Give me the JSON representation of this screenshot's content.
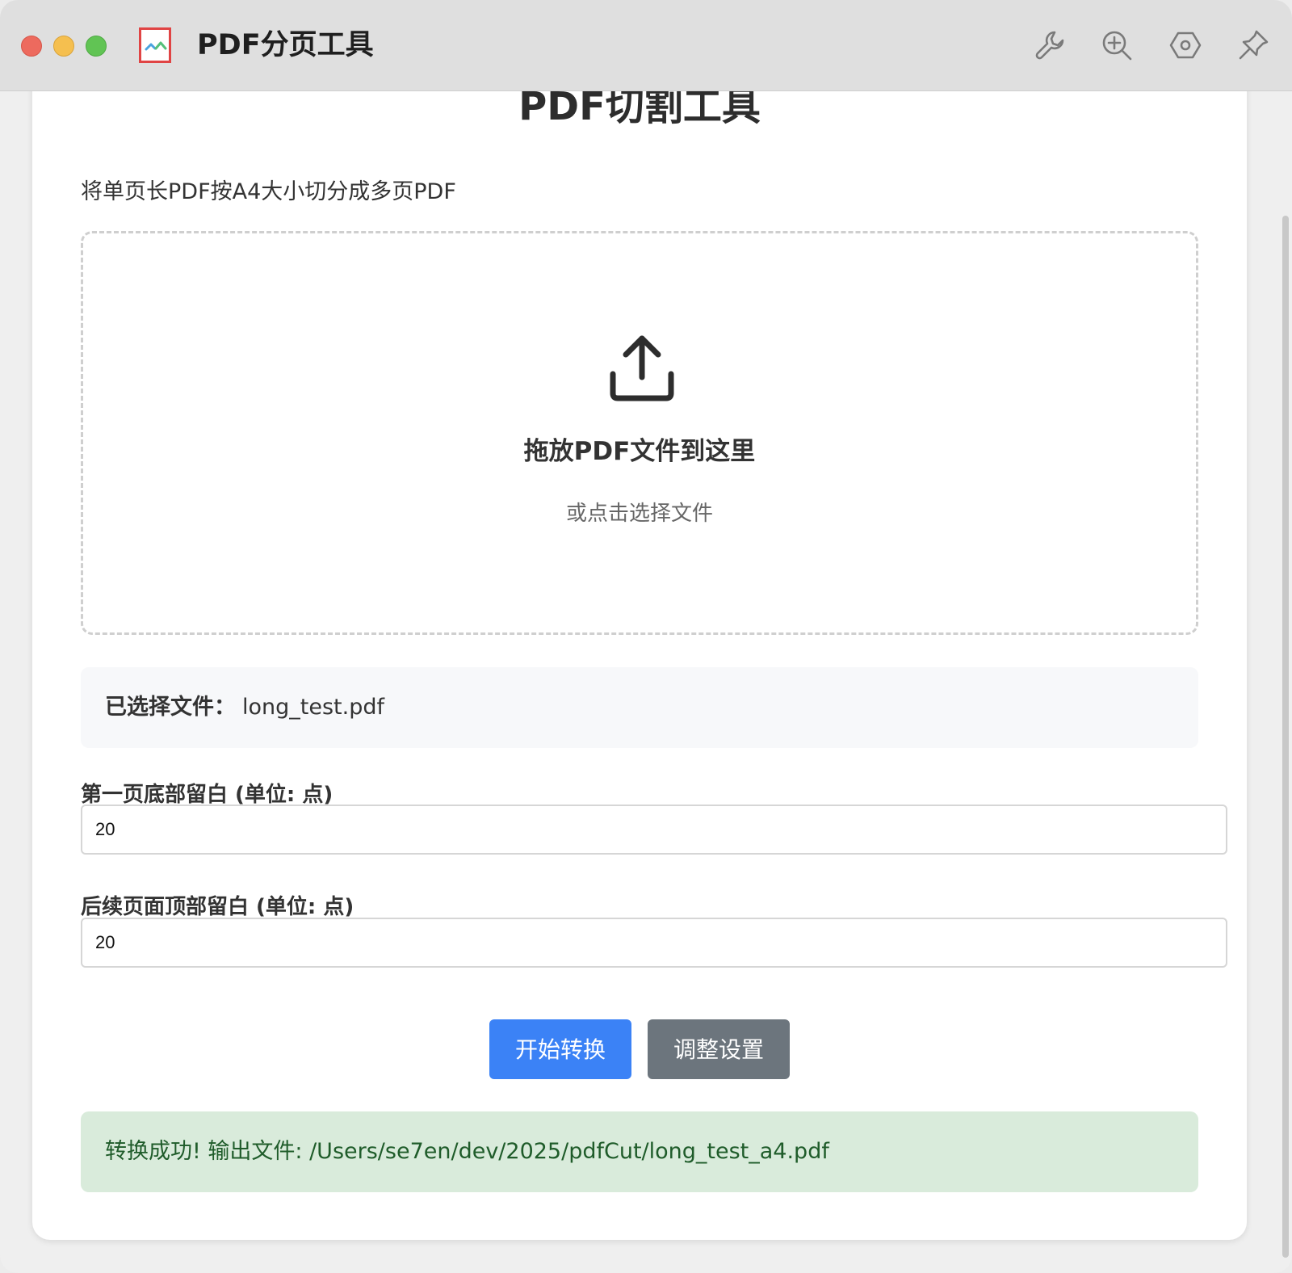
{
  "window": {
    "title": "PDF分页工具"
  },
  "toolbar": {
    "icons": [
      "wrench-icon",
      "zoom-in-icon",
      "hexagon-settings-icon",
      "pin-icon"
    ]
  },
  "main": {
    "heading": "PDF切割工具",
    "subtitle": "将单页长PDF按A4大小切分成多页PDF",
    "dropzone": {
      "title": "拖放PDF文件到这里",
      "subtitle": "或点击选择文件"
    },
    "selected_file": {
      "label": "已选择文件：",
      "name": "long_test.pdf"
    },
    "first_page_margin": {
      "label": "第一页底部留白 (单位: 点)",
      "value": "20"
    },
    "following_page_margin": {
      "label": "后续页面顶部留白 (单位: 点)",
      "value": "20"
    },
    "buttons": {
      "convert": "开始转换",
      "settings": "调整设置"
    },
    "result": "转换成功! 输出文件: /Users/se7en/dev/2025/pdfCut/long_test_a4.pdf"
  },
  "colors": {
    "primary": "#3b82f6",
    "secondary": "#6c757d",
    "success_bg": "#d9ebdb",
    "success_text": "#1f5c2a"
  }
}
